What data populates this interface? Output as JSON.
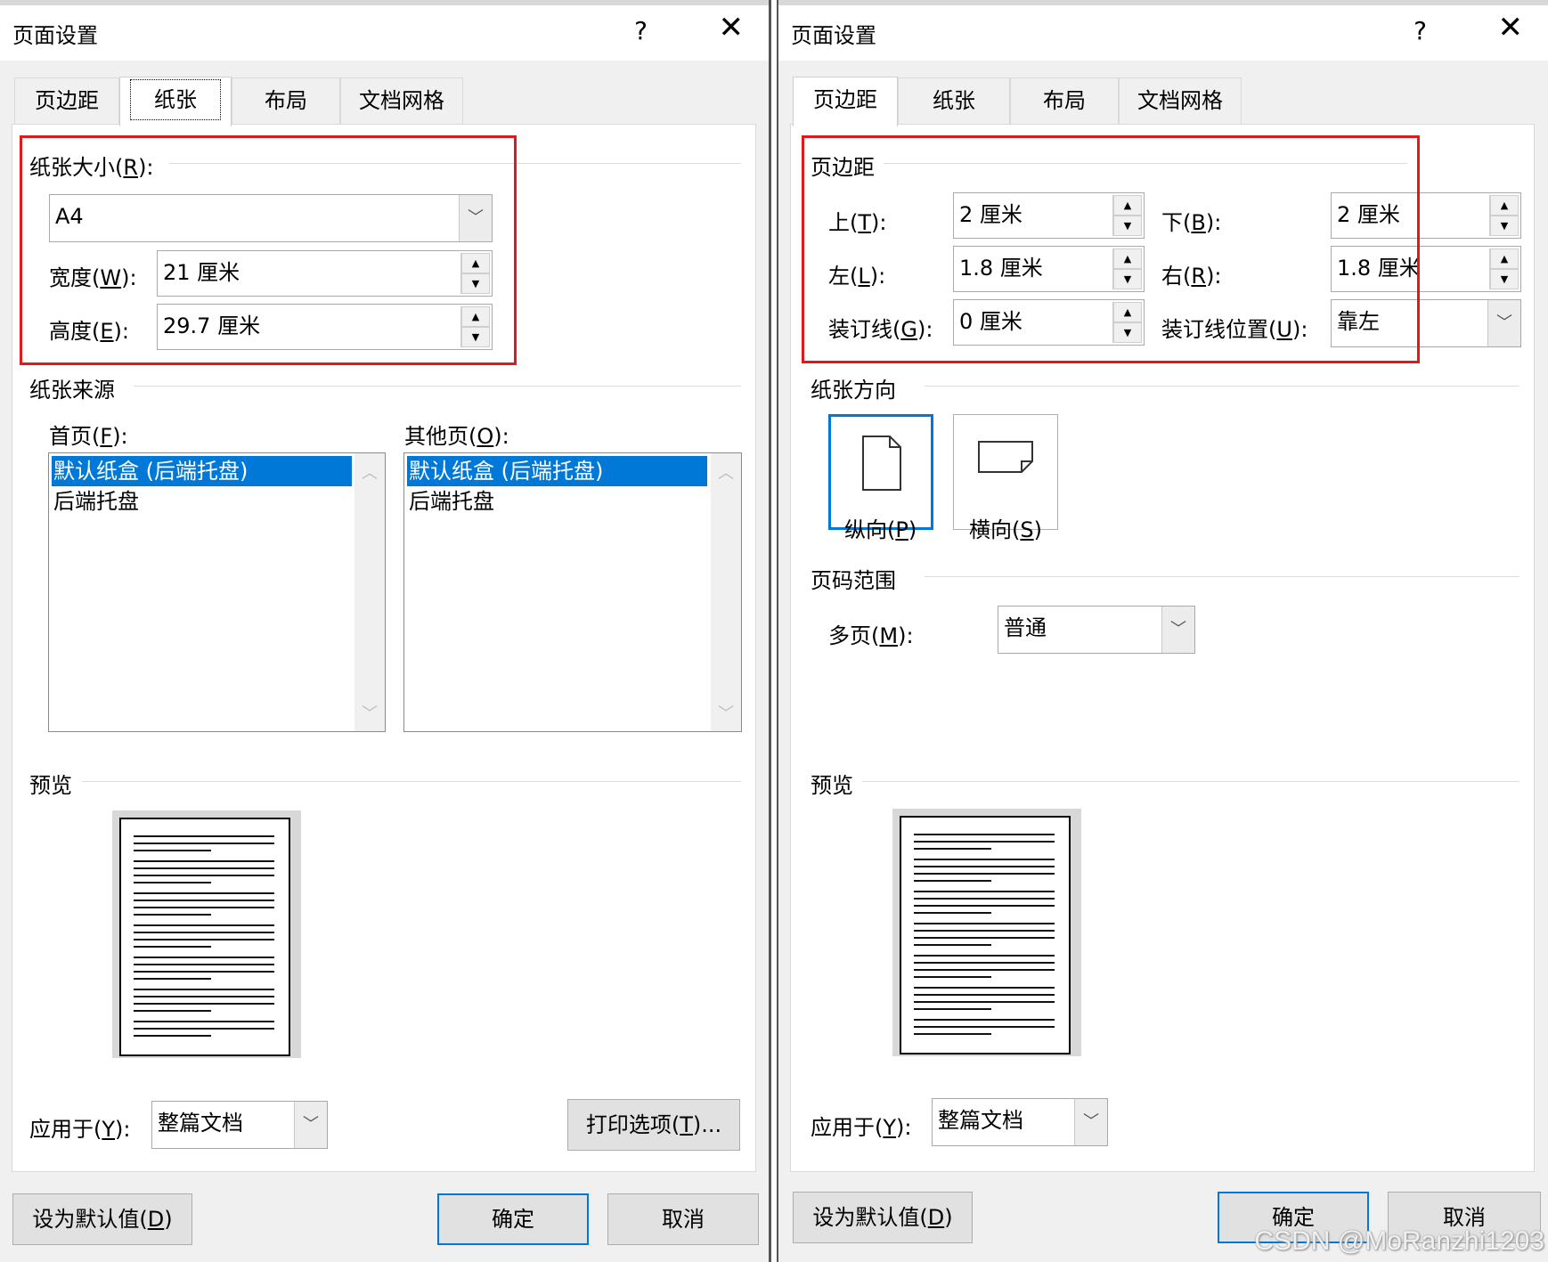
{
  "left": {
    "title": "页面设置",
    "help": "?",
    "close": "✕",
    "tabs": [
      "页边距",
      "纸张",
      "布局",
      "文档网格"
    ],
    "paper_size": {
      "label_pre": "纸张大小(",
      "label_key": "R",
      "label_post": "):",
      "value": "A4",
      "width_label_pre": "宽度(",
      "width_label_key": "W",
      "width_label_post": "):",
      "width_value": "21 厘米",
      "height_label_pre": "高度(",
      "height_label_key": "E",
      "height_label_post": "):",
      "height_value": "29.7 厘米"
    },
    "paper_source": {
      "section": "纸张来源",
      "first_label_pre": "首页(",
      "first_label_key": "F",
      "first_label_post": "):",
      "other_label_pre": "其他页(",
      "other_label_key": "O",
      "other_label_post": "):",
      "items": [
        "默认纸盒 (后端托盘)",
        "后端托盘"
      ]
    },
    "preview_label": "预览",
    "apply_label_pre": "应用于(",
    "apply_label_key": "Y",
    "apply_label_post": "):",
    "apply_value": "整篇文档",
    "print_options_pre": "打印选项(",
    "print_options_key": "T",
    "print_options_post": ")...",
    "default_pre": "设为默认值(",
    "default_key": "D",
    "default_post": ")",
    "ok": "确定",
    "cancel": "取消"
  },
  "right": {
    "title": "页面设置",
    "help": "?",
    "close": "✕",
    "tabs": [
      "页边距",
      "纸张",
      "布局",
      "文档网格"
    ],
    "margins": {
      "section": "页边距",
      "top_pre": "上(",
      "top_key": "T",
      "top_post": "):",
      "top_value": "2 厘米",
      "bottom_pre": "下(",
      "bottom_key": "B",
      "bottom_post": "):",
      "bottom_value": "2 厘米",
      "left_pre": "左(",
      "left_key": "L",
      "left_post": "):",
      "left_value": "1.8 厘米",
      "right_pre": "右(",
      "right_key": "R",
      "right_post": "):",
      "right_value": "1.8 厘米",
      "gutter_pre": "装订线(",
      "gutter_key": "G",
      "gutter_post": "):",
      "gutter_value": "0 厘米",
      "gutter_pos_pre": "装订线位置(",
      "gutter_pos_key": "U",
      "gutter_pos_post": "):",
      "gutter_pos_value": "靠左"
    },
    "orientation": {
      "section": "纸张方向",
      "portrait_pre": "纵向(",
      "portrait_key": "P",
      "portrait_post": ")",
      "landscape_pre": "横向(",
      "landscape_key": "S",
      "landscape_post": ")"
    },
    "pages": {
      "section": "页码范围",
      "multi_pre": "多页(",
      "multi_key": "M",
      "multi_post": "):",
      "multi_value": "普通"
    },
    "preview_label": "预览",
    "apply_label_pre": "应用于(",
    "apply_label_key": "Y",
    "apply_label_post": "):",
    "apply_value": "整篇文档",
    "default_pre": "设为默认值(",
    "default_key": "D",
    "default_post": ")",
    "ok": "确定",
    "cancel": "取消"
  },
  "watermark": "CSDN @MoRanzhi1203",
  "colors": {
    "highlight": "#e0191b",
    "selection": "#0078d7"
  },
  "icons": [
    "help-icon",
    "close-icon",
    "chevron-down-icon",
    "spin-up-icon",
    "spin-down-icon",
    "portrait-page-icon",
    "landscape-page-icon"
  ]
}
